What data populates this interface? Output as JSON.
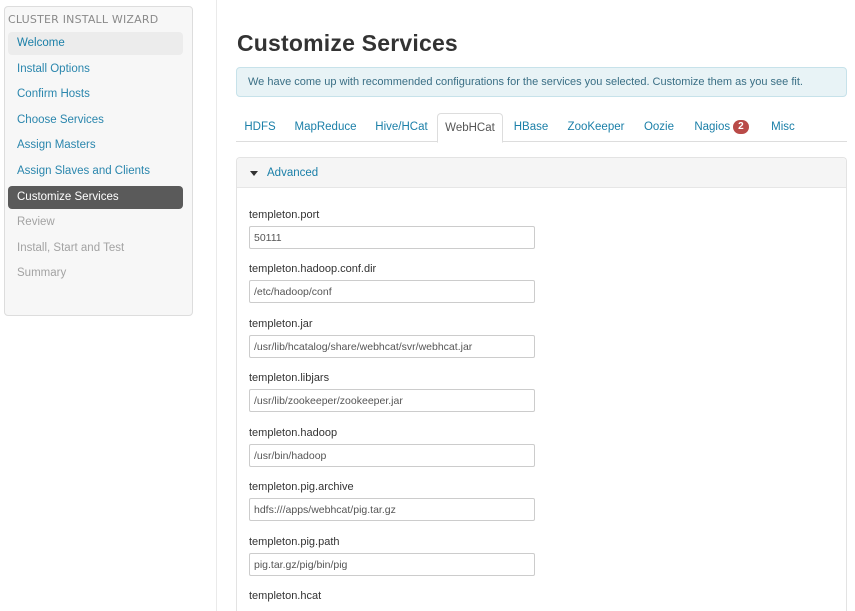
{
  "sidebar": {
    "title": "CLUSTER INSTALL WIZARD",
    "items": [
      {
        "label": "Welcome",
        "state": "first"
      },
      {
        "label": "Install Options",
        "state": "done"
      },
      {
        "label": "Confirm Hosts",
        "state": "done"
      },
      {
        "label": "Choose Services",
        "state": "done"
      },
      {
        "label": "Assign Masters",
        "state": "done"
      },
      {
        "label": "Assign Slaves and Clients",
        "state": "done"
      },
      {
        "label": "Customize Services",
        "state": "active"
      },
      {
        "label": "Review",
        "state": "disabled"
      },
      {
        "label": "Install, Start and Test",
        "state": "disabled"
      },
      {
        "label": "Summary",
        "state": "disabled"
      }
    ]
  },
  "main": {
    "title": "Customize Services",
    "info": "We have come up with recommended configurations for the services you selected. Customize them as you see fit.",
    "tabs": [
      {
        "label": "HDFS"
      },
      {
        "label": "MapReduce"
      },
      {
        "label": "Hive/HCat"
      },
      {
        "label": "WebHCat",
        "active": true
      },
      {
        "label": "HBase"
      },
      {
        "label": "ZooKeeper"
      },
      {
        "label": "Oozie"
      },
      {
        "label": "Nagios",
        "badge": "2"
      },
      {
        "label": "Misc"
      }
    ],
    "section": {
      "label": "Advanced",
      "fields": [
        {
          "label": "templeton.port",
          "value": "50111"
        },
        {
          "label": "templeton.hadoop.conf.dir",
          "value": "/etc/hadoop/conf"
        },
        {
          "label": "templeton.jar",
          "value": "/usr/lib/hcatalog/share/webhcat/svr/webhcat.jar"
        },
        {
          "label": "templeton.libjars",
          "value": "/usr/lib/zookeeper/zookeeper.jar"
        },
        {
          "label": "templeton.hadoop",
          "value": "/usr/bin/hadoop"
        },
        {
          "label": "templeton.pig.archive",
          "value": "hdfs:///apps/webhcat/pig.tar.gz"
        },
        {
          "label": "templeton.pig.path",
          "value": "pig.tar.gz/pig/bin/pig"
        },
        {
          "label": "templeton.hcat",
          "value": ""
        }
      ]
    }
  },
  "colors": {
    "link": "#1a7fa8",
    "active_nav_bg": "#5a5a5a",
    "badge": "#b94a48",
    "info_bg": "#e8f3f6"
  }
}
